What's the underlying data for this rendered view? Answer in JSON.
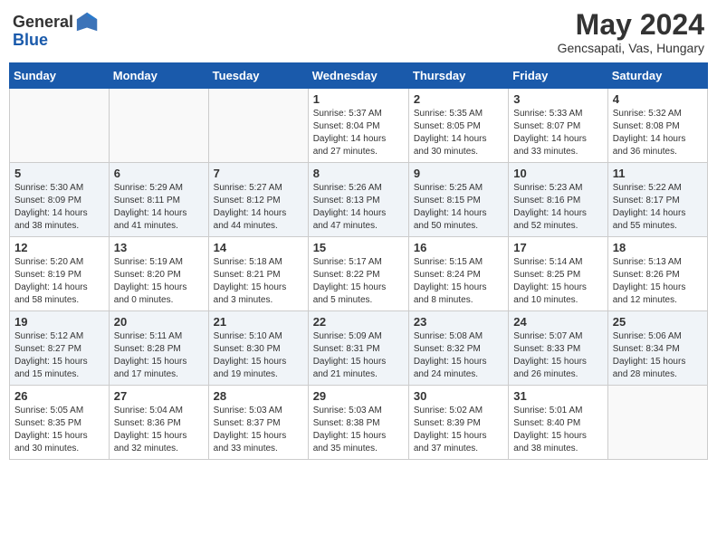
{
  "header": {
    "logo_general": "General",
    "logo_blue": "Blue",
    "month_year": "May 2024",
    "location": "Gencsapati, Vas, Hungary"
  },
  "weekdays": [
    "Sunday",
    "Monday",
    "Tuesday",
    "Wednesday",
    "Thursday",
    "Friday",
    "Saturday"
  ],
  "weeks": [
    [
      {
        "day": "",
        "info": ""
      },
      {
        "day": "",
        "info": ""
      },
      {
        "day": "",
        "info": ""
      },
      {
        "day": "1",
        "info": "Sunrise: 5:37 AM\nSunset: 8:04 PM\nDaylight: 14 hours\nand 27 minutes."
      },
      {
        "day": "2",
        "info": "Sunrise: 5:35 AM\nSunset: 8:05 PM\nDaylight: 14 hours\nand 30 minutes."
      },
      {
        "day": "3",
        "info": "Sunrise: 5:33 AM\nSunset: 8:07 PM\nDaylight: 14 hours\nand 33 minutes."
      },
      {
        "day": "4",
        "info": "Sunrise: 5:32 AM\nSunset: 8:08 PM\nDaylight: 14 hours\nand 36 minutes."
      }
    ],
    [
      {
        "day": "5",
        "info": "Sunrise: 5:30 AM\nSunset: 8:09 PM\nDaylight: 14 hours\nand 38 minutes."
      },
      {
        "day": "6",
        "info": "Sunrise: 5:29 AM\nSunset: 8:11 PM\nDaylight: 14 hours\nand 41 minutes."
      },
      {
        "day": "7",
        "info": "Sunrise: 5:27 AM\nSunset: 8:12 PM\nDaylight: 14 hours\nand 44 minutes."
      },
      {
        "day": "8",
        "info": "Sunrise: 5:26 AM\nSunset: 8:13 PM\nDaylight: 14 hours\nand 47 minutes."
      },
      {
        "day": "9",
        "info": "Sunrise: 5:25 AM\nSunset: 8:15 PM\nDaylight: 14 hours\nand 50 minutes."
      },
      {
        "day": "10",
        "info": "Sunrise: 5:23 AM\nSunset: 8:16 PM\nDaylight: 14 hours\nand 52 minutes."
      },
      {
        "day": "11",
        "info": "Sunrise: 5:22 AM\nSunset: 8:17 PM\nDaylight: 14 hours\nand 55 minutes."
      }
    ],
    [
      {
        "day": "12",
        "info": "Sunrise: 5:20 AM\nSunset: 8:19 PM\nDaylight: 14 hours\nand 58 minutes."
      },
      {
        "day": "13",
        "info": "Sunrise: 5:19 AM\nSunset: 8:20 PM\nDaylight: 15 hours\nand 0 minutes."
      },
      {
        "day": "14",
        "info": "Sunrise: 5:18 AM\nSunset: 8:21 PM\nDaylight: 15 hours\nand 3 minutes."
      },
      {
        "day": "15",
        "info": "Sunrise: 5:17 AM\nSunset: 8:22 PM\nDaylight: 15 hours\nand 5 minutes."
      },
      {
        "day": "16",
        "info": "Sunrise: 5:15 AM\nSunset: 8:24 PM\nDaylight: 15 hours\nand 8 minutes."
      },
      {
        "day": "17",
        "info": "Sunrise: 5:14 AM\nSunset: 8:25 PM\nDaylight: 15 hours\nand 10 minutes."
      },
      {
        "day": "18",
        "info": "Sunrise: 5:13 AM\nSunset: 8:26 PM\nDaylight: 15 hours\nand 12 minutes."
      }
    ],
    [
      {
        "day": "19",
        "info": "Sunrise: 5:12 AM\nSunset: 8:27 PM\nDaylight: 15 hours\nand 15 minutes."
      },
      {
        "day": "20",
        "info": "Sunrise: 5:11 AM\nSunset: 8:28 PM\nDaylight: 15 hours\nand 17 minutes."
      },
      {
        "day": "21",
        "info": "Sunrise: 5:10 AM\nSunset: 8:30 PM\nDaylight: 15 hours\nand 19 minutes."
      },
      {
        "day": "22",
        "info": "Sunrise: 5:09 AM\nSunset: 8:31 PM\nDaylight: 15 hours\nand 21 minutes."
      },
      {
        "day": "23",
        "info": "Sunrise: 5:08 AM\nSunset: 8:32 PM\nDaylight: 15 hours\nand 24 minutes."
      },
      {
        "day": "24",
        "info": "Sunrise: 5:07 AM\nSunset: 8:33 PM\nDaylight: 15 hours\nand 26 minutes."
      },
      {
        "day": "25",
        "info": "Sunrise: 5:06 AM\nSunset: 8:34 PM\nDaylight: 15 hours\nand 28 minutes."
      }
    ],
    [
      {
        "day": "26",
        "info": "Sunrise: 5:05 AM\nSunset: 8:35 PM\nDaylight: 15 hours\nand 30 minutes."
      },
      {
        "day": "27",
        "info": "Sunrise: 5:04 AM\nSunset: 8:36 PM\nDaylight: 15 hours\nand 32 minutes."
      },
      {
        "day": "28",
        "info": "Sunrise: 5:03 AM\nSunset: 8:37 PM\nDaylight: 15 hours\nand 33 minutes."
      },
      {
        "day": "29",
        "info": "Sunrise: 5:03 AM\nSunset: 8:38 PM\nDaylight: 15 hours\nand 35 minutes."
      },
      {
        "day": "30",
        "info": "Sunrise: 5:02 AM\nSunset: 8:39 PM\nDaylight: 15 hours\nand 37 minutes."
      },
      {
        "day": "31",
        "info": "Sunrise: 5:01 AM\nSunset: 8:40 PM\nDaylight: 15 hours\nand 38 minutes."
      },
      {
        "day": "",
        "info": ""
      }
    ]
  ]
}
